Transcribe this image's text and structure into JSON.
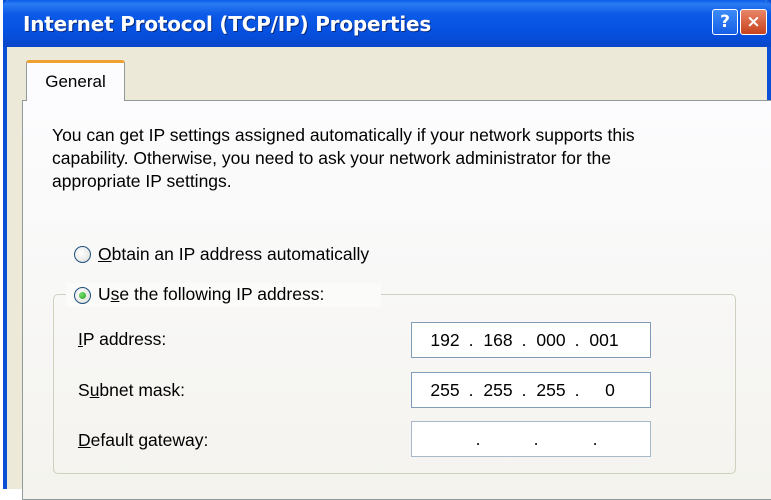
{
  "window": {
    "title": "Internet Protocol (TCP/IP) Properties",
    "help_glyph": "?",
    "close_glyph": "×"
  },
  "tabs": [
    {
      "label": "General",
      "active": true
    }
  ],
  "description": "You can get IP settings assigned automatically if your network supports this capability. Otherwise, you need to ask your network administrator for the appropriate IP settings.",
  "radios": {
    "auto": {
      "prefix": "",
      "hotkey": "O",
      "rest": "btain an IP address automatically",
      "selected": false
    },
    "manual": {
      "prefix": "U",
      "hotkey": "s",
      "rest": "e the following IP address:",
      "selected": true
    }
  },
  "fields": {
    "ip": {
      "prefix": "",
      "hotkey": "I",
      "rest": "P address:",
      "octets": [
        "192",
        "168",
        "000",
        "001"
      ]
    },
    "subnet": {
      "prefix": "S",
      "hotkey": "u",
      "rest": "bnet mask:",
      "octets": [
        "255",
        "255",
        "255",
        "0"
      ]
    },
    "gateway": {
      "prefix": "",
      "hotkey": "D",
      "rest": "efault gateway:",
      "octets": [
        "",
        "",
        "",
        ""
      ]
    }
  },
  "separator": ".",
  "colors": {
    "titlebar": "#0650e0",
    "tab_highlight": "#f0a030",
    "radio_dot": "#21a121",
    "dialog_bg": "#ece9d8"
  }
}
